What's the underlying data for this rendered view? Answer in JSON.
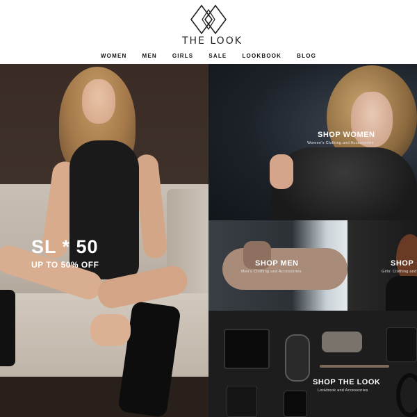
{
  "brand": {
    "name": "THE LOOK",
    "logo_icon": "double-diamond-logo"
  },
  "nav": {
    "items": [
      {
        "label": "WOMEN"
      },
      {
        "label": "MEN"
      },
      {
        "label": "GIRLS"
      },
      {
        "label": "SALE"
      },
      {
        "label": "LOOKBOOK"
      },
      {
        "label": "BLOG"
      }
    ]
  },
  "hero": {
    "title": "SL * 50",
    "subtitle": "UP TO 50% OFF"
  },
  "tiles": {
    "women": {
      "title": "SHOP WOMEN",
      "subtitle": "Women's Clothing and Accessories"
    },
    "men": {
      "title": "SHOP MEN",
      "subtitle": "Men's Clothing and Accessories"
    },
    "girls": {
      "title": "SHOP",
      "subtitle": "Girls' Clothing and"
    },
    "look": {
      "title": "SHOP THE LOOK",
      "subtitle": "Lookbook and Accessories"
    }
  },
  "colors": {
    "header_bg": "#ffffff",
    "text_dark": "#111111",
    "overlay_text": "#ffffff"
  }
}
